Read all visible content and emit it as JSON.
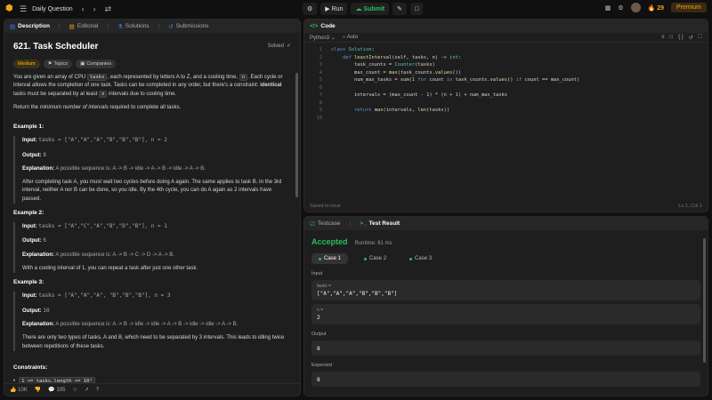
{
  "nav": {
    "title": "Daily Question",
    "run_label": "Run",
    "submit_label": "Submit",
    "streak": "29",
    "premium_label": "Premium"
  },
  "desc_tabs": [
    "Description",
    "Editorial",
    "Solutions",
    "Submissions"
  ],
  "problem": {
    "title": "621. Task Scheduler",
    "status": "Solved",
    "tags": [
      "Medium",
      "Topics",
      "Companies"
    ],
    "intro_1": "You are given an array of CPU",
    "intro_code": "tasks",
    "intro_2": ", each represented by letters A to Z, and a cooling time,",
    "intro_n": "n",
    "intro_3": ". Each cycle or interval allows the completion of one task. Tasks can be completed in any order, but there's a constraint:",
    "intro_bold": "identical",
    "intro_4": "tasks must be separated by at least",
    "intro_5": "intervals due to cooling time.",
    "return_1": "Return the",
    "return_em": "minimum number of intervals",
    "return_2": "required to complete all tasks."
  },
  "examples": [
    {
      "heading": "Example 1:",
      "input_label": "Input:",
      "input": "tasks = [\"A\",\"A\",\"A\",\"B\",\"B\",\"B\"], n = 2",
      "output_label": "Output:",
      "output": "8",
      "explanation_label": "Explanation:",
      "explanation": "A possible sequence is: A -> B -> idle -> A -> B -> idle -> A -> B.",
      "note": "After completing task A, you must wait two cycles before doing A again. The same applies to task B. In the 3rd interval, neither A nor B can be done, so you idle. By the 4th cycle, you can do A again as 2 intervals have passed."
    },
    {
      "heading": "Example 2:",
      "input_label": "Input:",
      "input": "tasks = [\"A\",\"C\",\"A\",\"B\",\"D\",\"B\"], n = 1",
      "output_label": "Output:",
      "output": "6",
      "explanation_label": "Explanation:",
      "explanation": "A possible sequence is: A -> B -> C -> D -> A -> B.",
      "note": "With a cooling interval of 1, you can repeat a task after just one other task."
    },
    {
      "heading": "Example 3:",
      "input_label": "Input:",
      "input": "tasks = [\"A\",\"A\",\"A\", \"B\",\"B\",\"B\"], n = 3",
      "output_label": "Output:",
      "output": "10",
      "explanation_label": "Explanation:",
      "explanation": "A possible sequence is: A -> B -> idle -> idle -> A -> B -> idle -> idle -> A -> B.",
      "note": "There are only two types of tasks, A and B, which need to be separated by 3 intervals. This leads to idling twice between repetitions of these tasks."
    }
  ],
  "constraints": {
    "heading": "Constraints:",
    "item": "1 <= tasks.length <= 10⁴"
  },
  "footer": {
    "likes": "10K",
    "comments": "105"
  },
  "code_panel": {
    "title": "Code",
    "language": "Python3",
    "mode": "Auto",
    "saved": "Saved to local",
    "cursor": "Ln 1, Col 1",
    "lines": [
      "class Solution:",
      "    def leastInterval(self, tasks, n) -> int:",
      "        task_counts = Counter(tasks)",
      "        max_count = max(task_counts.values())",
      "        num_max_tasks = sum(1 for count in task_counts.values() if count == max_count)",
      "",
      "        intervals = (max_count - 1) * (n + 1) + num_max_tasks",
      "",
      "        return max(intervals, len(tasks))",
      ""
    ]
  },
  "result_panel": {
    "tab_testcase": "Testcase",
    "tab_result": "Test Result",
    "status": "Accepted",
    "runtime": "Runtime: 61 ms",
    "cases": [
      "Case 1",
      "Case 2",
      "Case 3"
    ],
    "input_label": "Input",
    "tasks_label": "tasks =",
    "tasks_value": "[\"A\",\"A\",\"A\",\"B\",\"B\",\"B\"]",
    "n_label": "n =",
    "n_value": "2",
    "output_label": "Output",
    "output_value": "8",
    "expected_label": "Expected",
    "expected_value": "8"
  },
  "colors": {
    "accent": "#f89f1b",
    "accepted": "#2cbb5d",
    "medium": "#ffb800"
  }
}
